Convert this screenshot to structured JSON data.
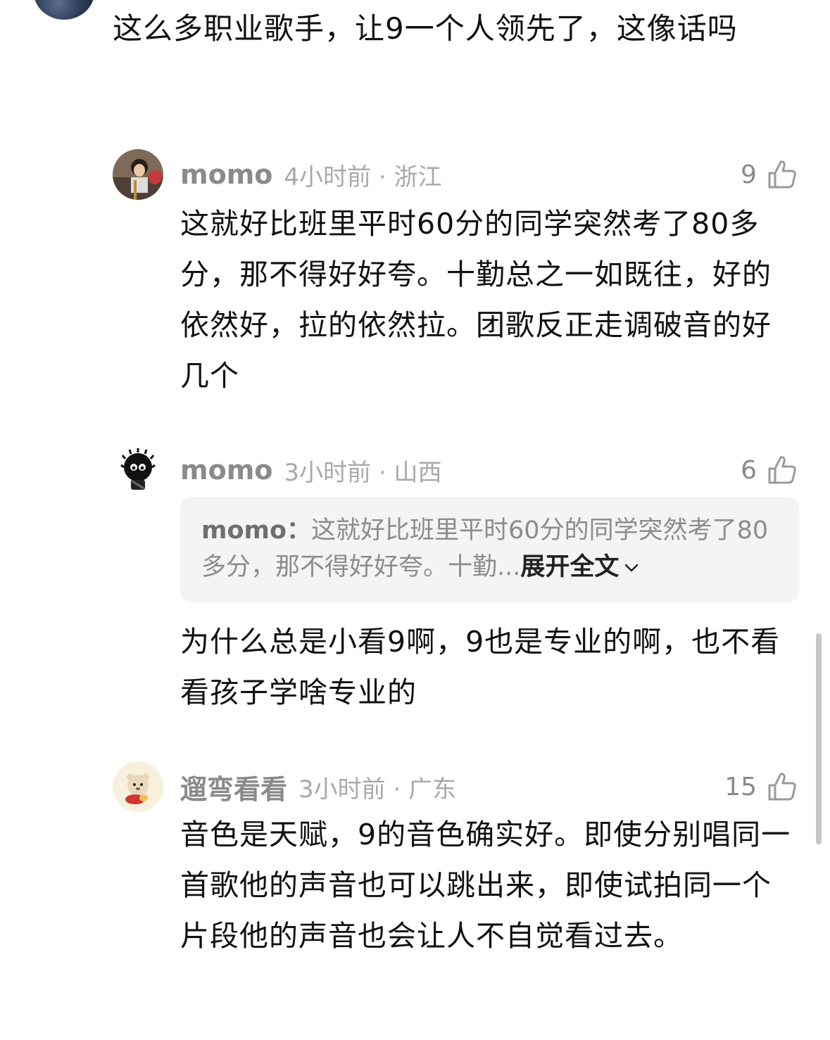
{
  "top_comment": {
    "text": "这么多职业歌手，让9一个人领先了，这像话吗"
  },
  "replies": [
    {
      "name": "momo",
      "time": "4小时前 · 浙江",
      "likes": "9",
      "text": "这就好比班里平时60分的同学突然考了80多分，那不得好好夸。十勤总之一如既往，好的依然好，拉的依然拉。团歌反正走调破音的好几个"
    },
    {
      "name": "momo",
      "time": "3小时前 · 山西",
      "likes": "6",
      "quote": {
        "name": "momo：",
        "text": "这就好比班里平时60分的同学突然考了80多分，那不得好好夸。十勤...",
        "expand": "展开全文"
      },
      "text": "为什么总是小看9啊，9也是专业的啊，也不看看孩子学啥专业的"
    },
    {
      "name": "遛弯看看",
      "time": "3小时前 · 广东",
      "likes": "15",
      "text": "音色是天赋，9的音色确实好。即使分别唱同一首歌他的声音也可以跳出来，即使试拍同一个片段他的声音也会让人不自觉看过去。"
    }
  ],
  "icons": {
    "like": "thumbs-up-icon",
    "expand": "chevron-down-icon"
  }
}
